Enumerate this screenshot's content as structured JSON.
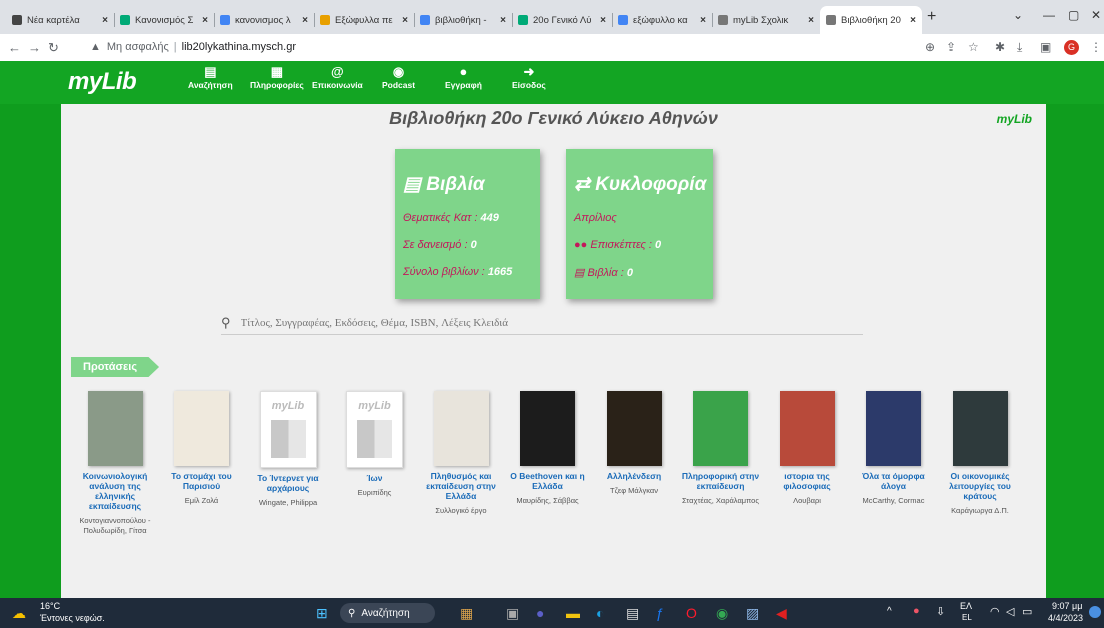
{
  "browser": {
    "tabs": [
      {
        "label": "Νέα καρτέλα",
        "color": "#444"
      },
      {
        "label": "Κανονισμός Σ",
        "color": "#0a7"
      },
      {
        "label": "κανονισμος λ",
        "color": "#4285f4"
      },
      {
        "label": "Εξώφυλλα πε",
        "color": "#e8a000"
      },
      {
        "label": "βιβλιοθήκη -",
        "color": "#4285f4"
      },
      {
        "label": "20ο Γενικό Λύ",
        "color": "#0a7"
      },
      {
        "label": "εξώφυλλο κα",
        "color": "#4285f4"
      },
      {
        "label": "myLib Σχολικ",
        "color": "#777"
      },
      {
        "label": "Βιβλιοθήκη 20",
        "color": "#777"
      }
    ],
    "new_tab": "+",
    "address": {
      "security": "Μη ασφαλής",
      "url": "lib20lykathina.mysch.gr"
    },
    "profile_initial": "G"
  },
  "site": {
    "logo": "myLib",
    "menu": [
      {
        "label": "Αναζήτηση",
        "icon": "book-icon",
        "glyph": "▤"
      },
      {
        "label": "Πληροφορίες",
        "icon": "map-icon",
        "glyph": "▦"
      },
      {
        "label": "Επικοινωνία",
        "icon": "at-icon",
        "glyph": "@"
      },
      {
        "label": "Podcast",
        "icon": "podcast-icon",
        "glyph": "◉"
      },
      {
        "label": "Εγγραφή",
        "icon": "user-icon",
        "glyph": "●"
      },
      {
        "label": "Είσοδος",
        "icon": "login-icon",
        "glyph": "➜"
      }
    ],
    "title": "Βιβλιοθήκη 20ο Γενικό Λύκειο Αθηνών",
    "small_logo": "myLib",
    "card_books": {
      "heading": "Βιβλία",
      "rows": [
        {
          "label": "Θεματικές Κατ :",
          "value": "449"
        },
        {
          "label": "Σε δανεισμό :",
          "value": "0"
        },
        {
          "label": "Σύνολο βιβλίων :",
          "value": "1665"
        }
      ]
    },
    "card_circ": {
      "heading": "Κυκλοφορία",
      "month": "Απρίλιος",
      "rows": [
        {
          "label": "Επισκέπτες :",
          "value": "0"
        },
        {
          "label": "Βιβλία :",
          "value": "0"
        }
      ]
    },
    "search_placeholder": "Τίτλος, Συγγραφέας, Εκδόσεις, Θέμα, ISBN, Λέξεις Κλειδιά",
    "suggestions_label": "Προτάσεις",
    "books": [
      {
        "title": "Κοινωνιολογική ανάλυση της ελληνικής εκπαίδευσης",
        "author": "Κοντογιαννοπούλου - Πολυδωρίδη, Γίτσα",
        "cover": "#8a9a88"
      },
      {
        "title": "Το στομάχι του Παρισιού",
        "author": "Εμίλ Ζολά",
        "cover": "#efe9dd"
      },
      {
        "title": "Το Ίντερνετ για αρχάριους",
        "author": "Wingate, Philippa",
        "cover": "placeholder"
      },
      {
        "title": "Ίων",
        "author": "Ευριπίδης",
        "cover": "placeholder"
      },
      {
        "title": "Πληθυσμός και εκπαίδευση στην Ελλάδα",
        "author": "Συλλογικό έργο",
        "cover": "#e8e4dc"
      },
      {
        "title": "Ο Beethoven και η Ελλάδα",
        "author": "Μαυρίδης, Σάββας",
        "cover": "#1c1c1c"
      },
      {
        "title": "Αλληλένδεση",
        "author": "Τζεφ Μάλγκαν",
        "cover": "#2a2218"
      },
      {
        "title": "Πληροφορική στην εκπαίδευση",
        "author": "Σταχτέας, Χαράλαμπος",
        "cover": "#3aa34a"
      },
      {
        "title": "ιστορια της φιλοσοφιας",
        "author": "Λουβαρι",
        "cover": "#b84a3a"
      },
      {
        "title": "Όλα τα όμορφα άλογα",
        "author": "McCarthy, Cormac",
        "cover": "#2c3a6a"
      },
      {
        "title": "Οι οικονομικές λειτουργίες του κράτους",
        "author": "Καράγιωργα Δ.Π.",
        "cover": "#2e3a3c"
      }
    ]
  },
  "taskbar": {
    "weather_temp": "16°C",
    "weather_desc": "Έντονες νεφώσ.",
    "search": "Αναζήτηση",
    "lang": "ΕΛ",
    "lang2": "EL",
    "time": "9:07 μμ",
    "date": "4/4/2023"
  }
}
